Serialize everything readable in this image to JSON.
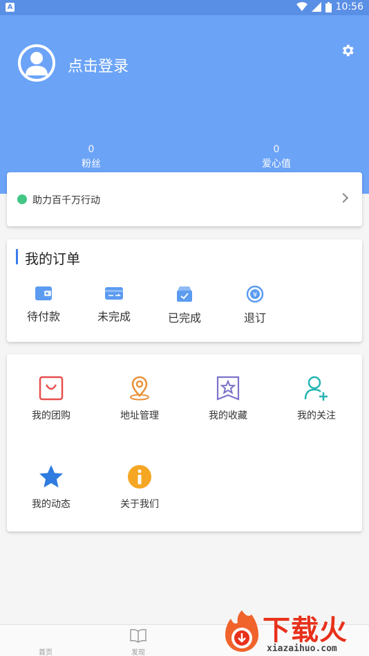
{
  "status_bar": {
    "time": "10:56"
  },
  "header": {
    "login_text": "点击登录"
  },
  "stats": [
    {
      "value": "0",
      "label": "粉丝"
    },
    {
      "value": "0",
      "label": "爱心值"
    }
  ],
  "promo": {
    "text": "助力百千万行动"
  },
  "orders": {
    "title": "我的订单",
    "items": [
      {
        "label": "待付款",
        "icon": "wallet-icon"
      },
      {
        "label": "未完成",
        "icon": "card-transfer-icon"
      },
      {
        "label": "已完成",
        "icon": "box-check-icon"
      },
      {
        "label": "退订",
        "icon": "refund-icon"
      }
    ]
  },
  "services": [
    {
      "label": "我的团购",
      "icon": "shopping-bag-icon",
      "color": "#e84d4d"
    },
    {
      "label": "地址管理",
      "icon": "location-pin-icon",
      "color": "#e8913b"
    },
    {
      "label": "我的收藏",
      "icon": "star-bookmark-icon",
      "color": "#7a73c9"
    },
    {
      "label": "我的关注",
      "icon": "add-user-icon",
      "color": "#23b5b3"
    },
    {
      "label": "我的动态",
      "icon": "star-icon",
      "color": "#2f7be0"
    },
    {
      "label": "关于我们",
      "icon": "info-icon",
      "color": "#f5a623"
    }
  ],
  "tabbar": [
    {
      "label": "首页"
    },
    {
      "label": "发现"
    }
  ],
  "watermark": {
    "brand": "下载火",
    "url": "xiazaihuo.com"
  },
  "colors": {
    "header": "#6ba3f7",
    "accent": "#3a7de9"
  }
}
